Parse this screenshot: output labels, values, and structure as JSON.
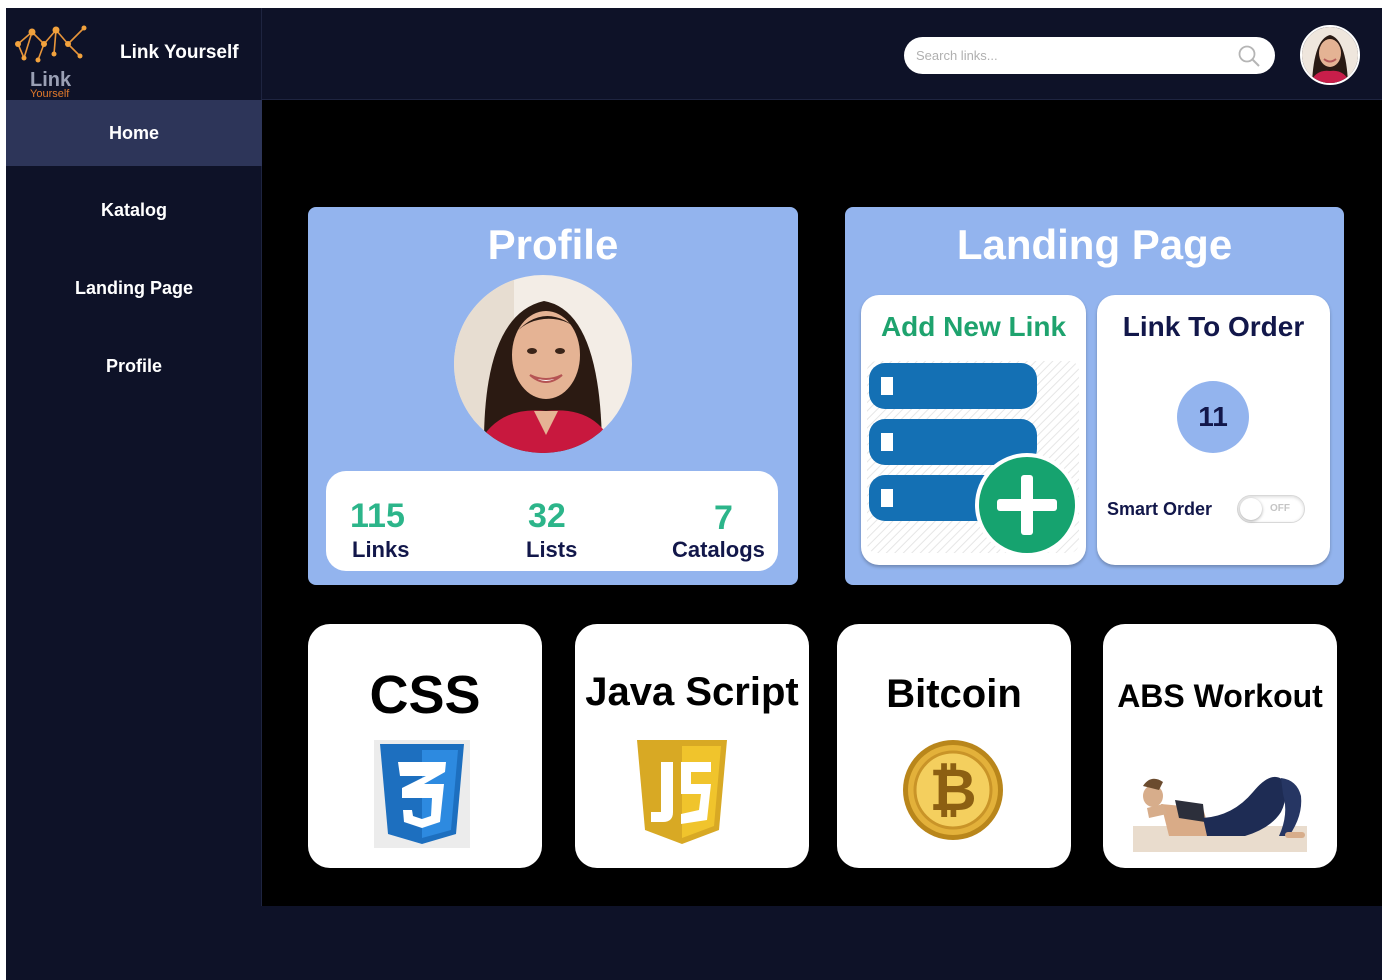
{
  "app": {
    "name": "Link Yourself",
    "logo_text": "Link",
    "logo_subtext": "Yourself"
  },
  "search": {
    "placeholder": "Search links...",
    "value": ""
  },
  "nav": [
    {
      "label": "Home",
      "active": true
    },
    {
      "label": "Katalog",
      "active": false
    },
    {
      "label": "Landing Page",
      "active": false
    },
    {
      "label": "Profile",
      "active": false
    }
  ],
  "profile_card": {
    "title": "Profile",
    "stats": [
      {
        "value": "115",
        "label": "Links"
      },
      {
        "value": "32",
        "label": "Lists"
      },
      {
        "value": "7",
        "label": "Catalogs"
      }
    ]
  },
  "landing_card": {
    "title": "Landing Page",
    "add_link": {
      "title": "Add New Link",
      "icon": "add-link-icon"
    },
    "link_to_order": {
      "title": "Link To Order",
      "count": "11",
      "smart_order_label": "Smart Order",
      "toggle_state": "OFF"
    }
  },
  "catalog_tiles": [
    {
      "title": "CSS",
      "icon": "css3-icon"
    },
    {
      "title": "Java Script",
      "icon": "javascript-icon"
    },
    {
      "title": "Bitcoin",
      "icon": "bitcoin-icon"
    },
    {
      "title": "ABS Workout",
      "icon": "workout-image"
    }
  ],
  "colors": {
    "nav_background": "#0e1228",
    "nav_active": "#2d3559",
    "card_blue": "#93b4ee",
    "stat_green": "#2cb58a",
    "dark_text": "#12174a",
    "add_green": "#16a36f",
    "link_blue": "#1470b4"
  }
}
